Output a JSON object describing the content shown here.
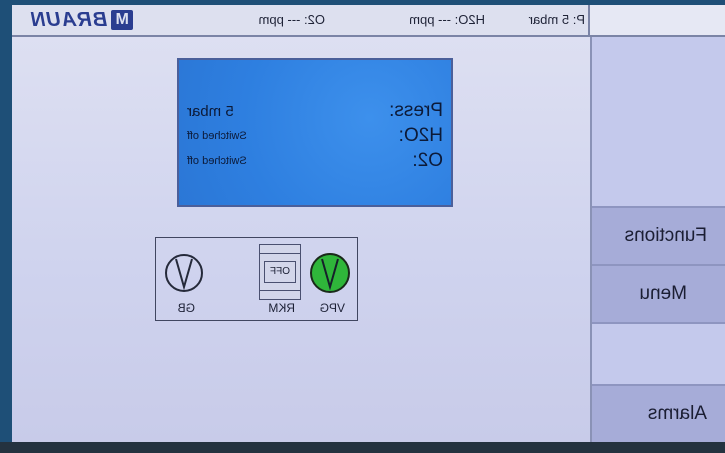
{
  "status": {
    "pressure": "P: 5 mbar",
    "h2o": "H2O: --- ppm",
    "o2": "O2: --- ppm",
    "logo_text": "BRAUN",
    "logo_mark": "M"
  },
  "info_panel": {
    "rows": [
      {
        "label": "Press:",
        "value": "5 mbar"
      },
      {
        "label": "H2O:",
        "value": "Switched off"
      },
      {
        "label": "O2:",
        "value": "Switched off"
      }
    ]
  },
  "diagram": {
    "vpg_label": "VPG",
    "rkm_label": "RKM",
    "rkm_state": "OFF",
    "gb_label": "GB",
    "vpg_color": "#2fb63a"
  },
  "menu": {
    "functions": "Functions",
    "menu": "Menu",
    "alarms": "Alarms"
  }
}
